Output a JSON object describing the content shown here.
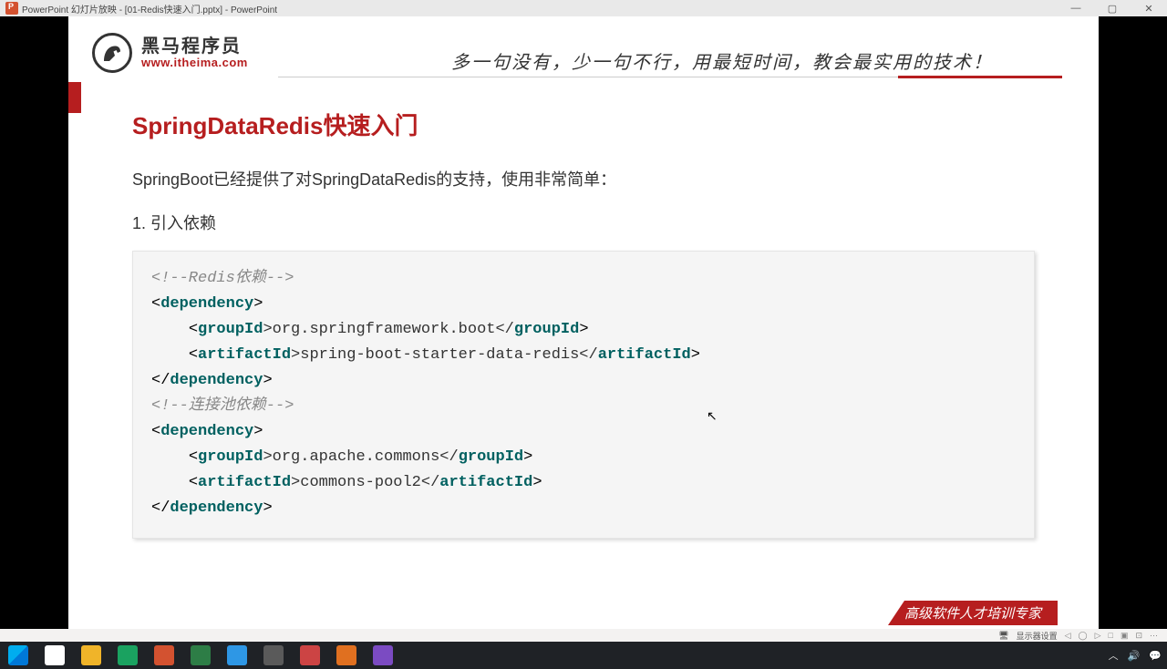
{
  "window": {
    "title": "PowerPoint 幻灯片放映 - [01-Redis快速入门.pptx] - PowerPoint"
  },
  "logo": {
    "cn": "黑马程序员",
    "url": "www.itheima.com"
  },
  "tagline": "多一句没有，少一句不行，用最短时间，教会最实用的技术！",
  "slide": {
    "heading": "SpringDataRedis快速入门",
    "intro": "SpringBoot已经提供了对SpringDataRedis的支持，使用非常简单：",
    "step1": "1.  引入依赖",
    "code": {
      "c1": "<!--Redis依赖-->",
      "l2_open": "<",
      "l2_tag": "dependency",
      "l2_close": ">",
      "l3_open": "<",
      "l3_tag": "groupId",
      "l3_mid": ">org.springframework.boot</",
      "l3_tag2": "groupId",
      "l3_end": ">",
      "l4_open": "<",
      "l4_tag": "artifactId",
      "l4_mid": ">spring-boot-starter-data-redis</",
      "l4_tag2": "artifactId",
      "l4_end": ">",
      "l5_open": "</",
      "l5_tag": "dependency",
      "l5_close": ">",
      "c2": "<!--连接池依赖-->",
      "l7_open": "<",
      "l7_tag": "dependency",
      "l7_close": ">",
      "l8_open": "<",
      "l8_tag": "groupId",
      "l8_mid": ">org.apache.commons</",
      "l8_tag2": "groupId",
      "l8_end": ">",
      "l9_open": "<",
      "l9_tag": "artifactId",
      "l9_mid": ">commons-pool2</",
      "l9_tag2": "artifactId",
      "l9_end": ">",
      "l10_open": "</",
      "l10_tag": "dependency",
      "l10_close": ">"
    }
  },
  "watermark": "高级软件人才培训专家",
  "bottombar": {
    "display": "显示器设置",
    "ctls": [
      "◁",
      "◯",
      "▷",
      "□",
      "▣",
      "⊡",
      "⋯"
    ]
  },
  "tray": {
    "up": "︿",
    "vol": "🔊",
    "msg": "💬"
  },
  "taskbar_colors": [
    "#ffffff",
    "#f0b429",
    "#1aa260",
    "#d35230",
    "#2d7d46",
    "#2e97e5",
    "#5a5a5a",
    "#cc4444",
    "#e07020",
    "#7b4bc2"
  ]
}
